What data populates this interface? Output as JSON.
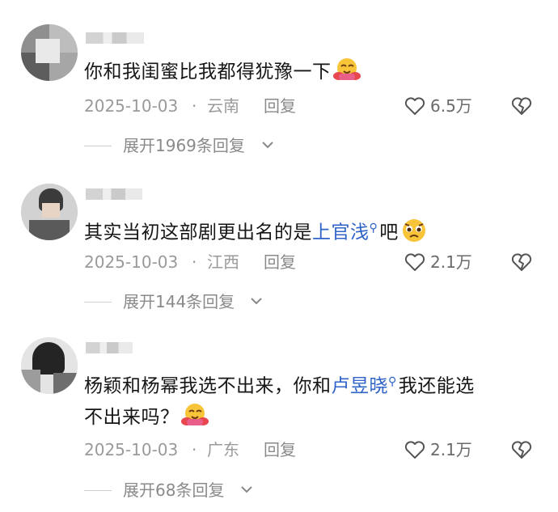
{
  "comments": [
    {
      "text": "你和我闺蜜比我都得犹豫一下",
      "emoji": "hugging-face-emoji",
      "date": "2025-10-03",
      "separator": "·",
      "region": "云南",
      "reply_label": "回复",
      "likes": "6.5万",
      "expand_label": "展开1969条回复"
    },
    {
      "text_before": "其实当初这部剧更出名的是",
      "mention": "上官浅",
      "text_after": "吧",
      "emoji": "pleading-face-emoji",
      "date": "2025-10-03",
      "separator": "·",
      "region": "江西",
      "reply_label": "回复",
      "likes": "2.1万",
      "expand_label": "展开144条回复"
    },
    {
      "text_before": "杨颖和杨幂我选不出来，你和",
      "mention": "卢昱晓",
      "text_after": "我还能选",
      "text_line2": "不出来吗？",
      "emoji": "hugging-face-emoji",
      "date": "2025-10-03",
      "separator": "·",
      "region": "广东",
      "reply_label": "回复",
      "likes": "2.1万",
      "expand_label": "展开68条回复"
    }
  ],
  "colors": {
    "mention": "#2f63c7",
    "meta": "#9a9a9a",
    "text": "#161616"
  }
}
